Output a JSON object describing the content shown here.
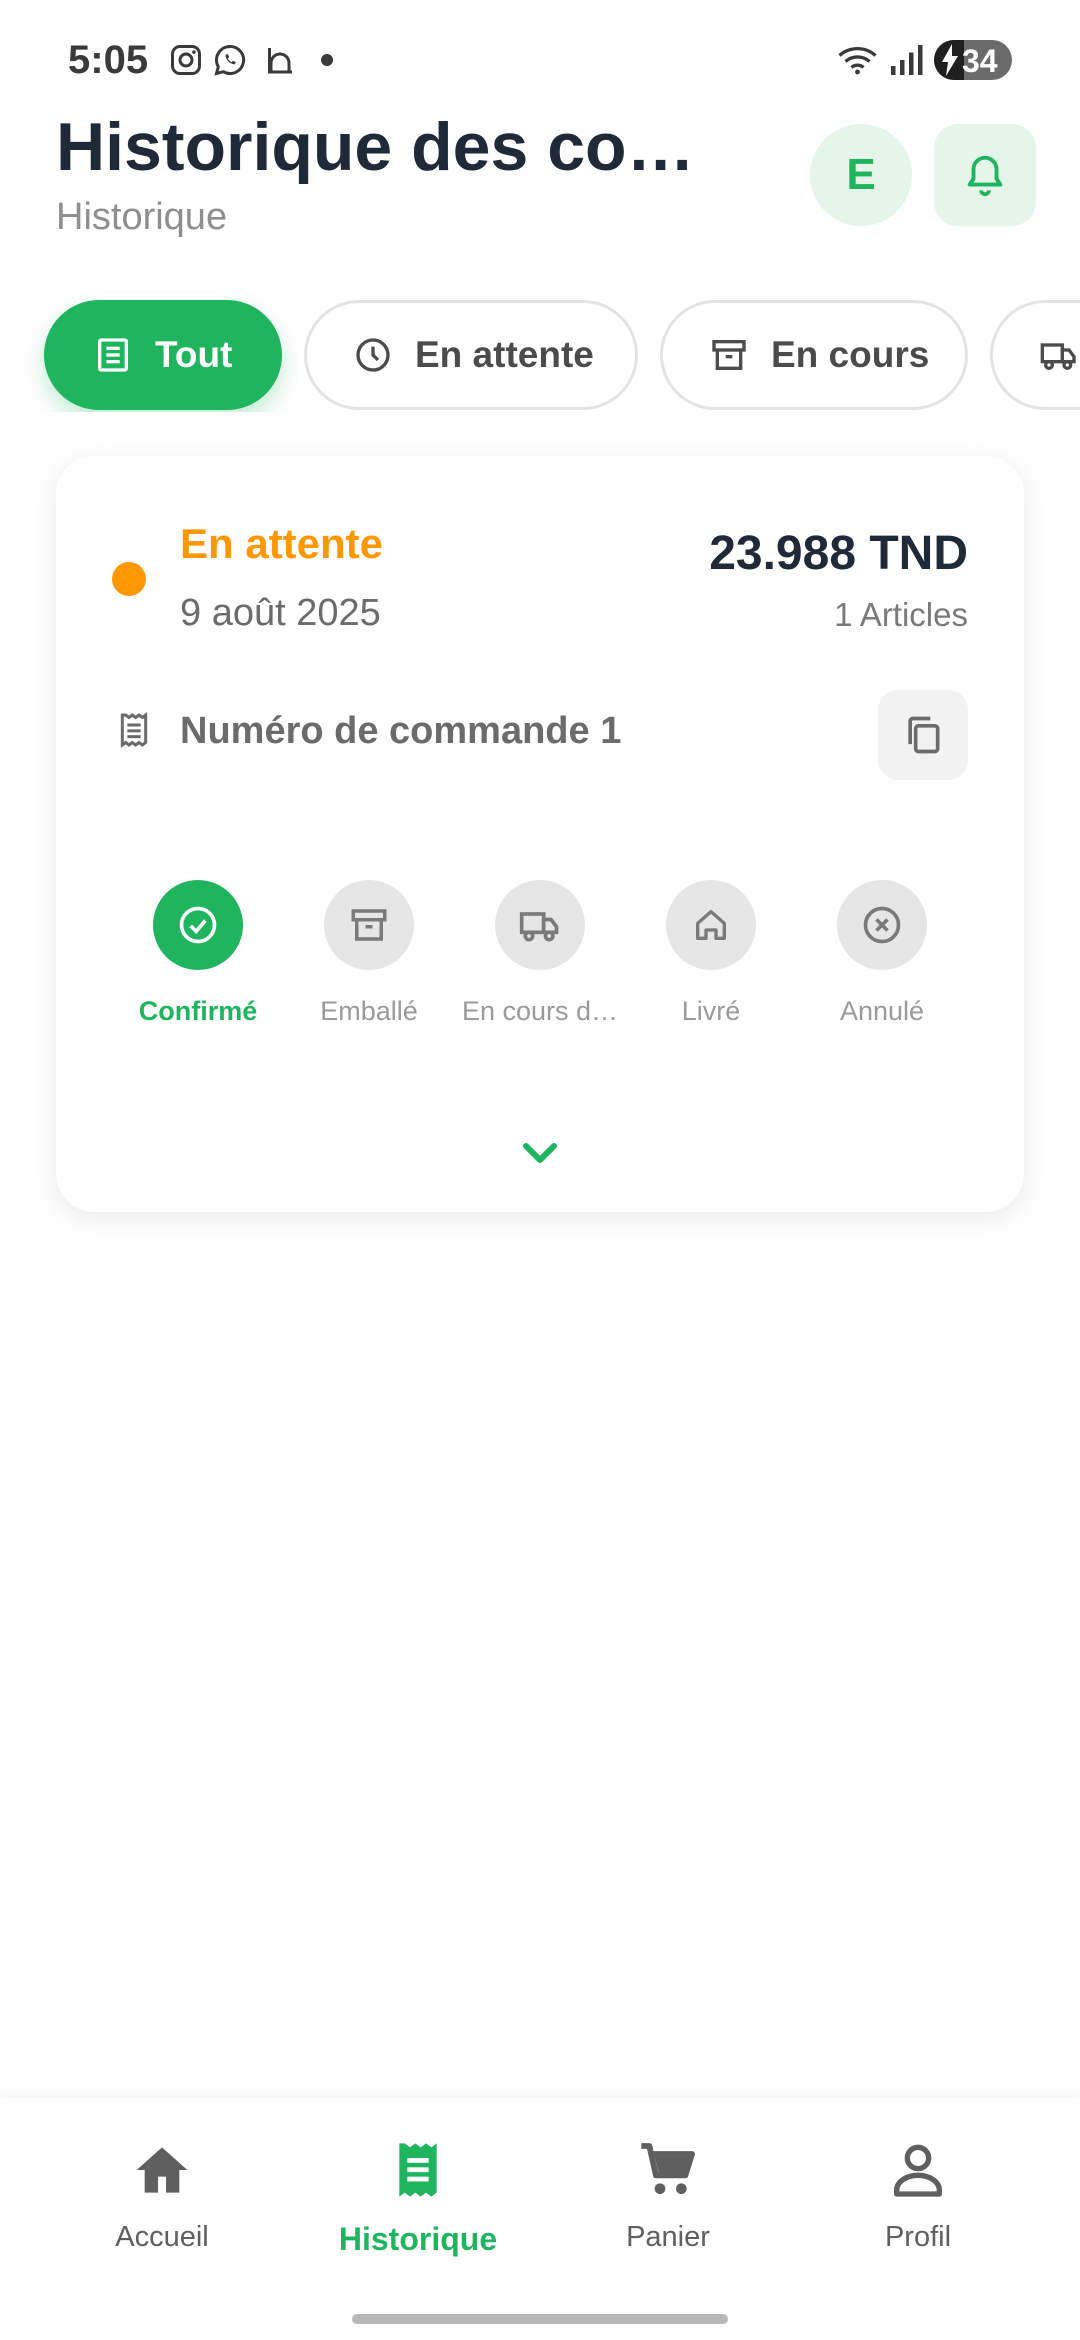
{
  "status_bar": {
    "time": "5:05",
    "battery": "34"
  },
  "header": {
    "title": "Historique des com…",
    "subtitle": "Historique",
    "avatar_initial": "E"
  },
  "filters": [
    {
      "label": "Tout",
      "icon": "receipt-icon",
      "active": true
    },
    {
      "label": "En attente",
      "icon": "clock-icon",
      "active": false
    },
    {
      "label": "En cours",
      "icon": "archive-box-icon",
      "active": false
    },
    {
      "label": "",
      "icon": "truck-icon",
      "active": false
    }
  ],
  "order": {
    "status": "En attente",
    "status_color": "#ff9800",
    "date": "9 août 2025",
    "total": "23.988 TND",
    "items": "1 Articles",
    "number_label": "Numéro de commande 1",
    "steps": [
      {
        "label": "Confirmé",
        "icon": "check-circle-icon",
        "done": true
      },
      {
        "label": "Emballé",
        "icon": "archive-box-icon",
        "done": false
      },
      {
        "label": "En cours d…",
        "icon": "truck-icon",
        "done": false
      },
      {
        "label": "Livré",
        "icon": "home-icon",
        "done": false
      },
      {
        "label": "Annulé",
        "icon": "cancel-circle-icon",
        "done": false
      }
    ]
  },
  "bottom_nav": [
    {
      "label": "Accueil",
      "icon": "home-icon",
      "active": false
    },
    {
      "label": "Historique",
      "icon": "receipt-icon",
      "active": true
    },
    {
      "label": "Panier",
      "icon": "cart-icon",
      "active": false
    },
    {
      "label": "Profil",
      "icon": "person-icon",
      "active": false
    }
  ],
  "colors": {
    "accent": "#1fb45e",
    "pending": "#ff9800",
    "text_dark": "#1f2937",
    "muted": "#8e8e8e"
  }
}
